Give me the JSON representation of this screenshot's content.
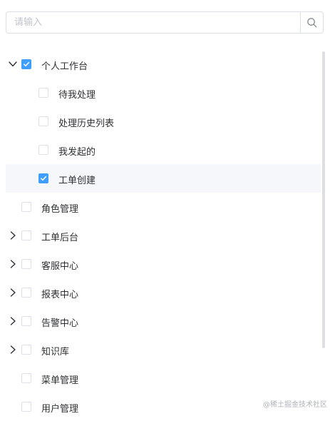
{
  "search": {
    "placeholder": "请输入",
    "icon": "search-icon"
  },
  "tree": {
    "nodes": [
      {
        "label": "个人工作台",
        "level": 0,
        "expander": "chevron-down",
        "checked": true,
        "active": false
      },
      {
        "label": "待我处理",
        "level": 1,
        "expander": "none",
        "checked": false,
        "active": false
      },
      {
        "label": "处理历史列表",
        "level": 1,
        "expander": "none",
        "checked": false,
        "active": false
      },
      {
        "label": "我发起的",
        "level": 1,
        "expander": "none",
        "checked": false,
        "active": false
      },
      {
        "label": "工单创建",
        "level": 1,
        "expander": "none",
        "checked": true,
        "active": true
      },
      {
        "label": "角色管理",
        "level": 0,
        "expander": "none",
        "checked": false,
        "active": false
      },
      {
        "label": "工单后台",
        "level": 0,
        "expander": "chevron-right",
        "checked": false,
        "active": false
      },
      {
        "label": "客服中心",
        "level": 0,
        "expander": "chevron-right",
        "checked": false,
        "active": false
      },
      {
        "label": "报表中心",
        "level": 0,
        "expander": "chevron-right",
        "checked": false,
        "active": false
      },
      {
        "label": "告警中心",
        "level": 0,
        "expander": "chevron-right",
        "checked": false,
        "active": false
      },
      {
        "label": "知识库",
        "level": 0,
        "expander": "chevron-right",
        "checked": false,
        "active": false
      },
      {
        "label": "菜单管理",
        "level": 0,
        "expander": "none",
        "checked": false,
        "active": false
      },
      {
        "label": "用户管理",
        "level": 0,
        "expander": "none",
        "checked": false,
        "active": false
      }
    ]
  },
  "colors": {
    "accent": "#409eff",
    "border": "#dcdfe6",
    "active_row": "#f5f7fa"
  },
  "watermark": "@稀土掘金技术社区"
}
